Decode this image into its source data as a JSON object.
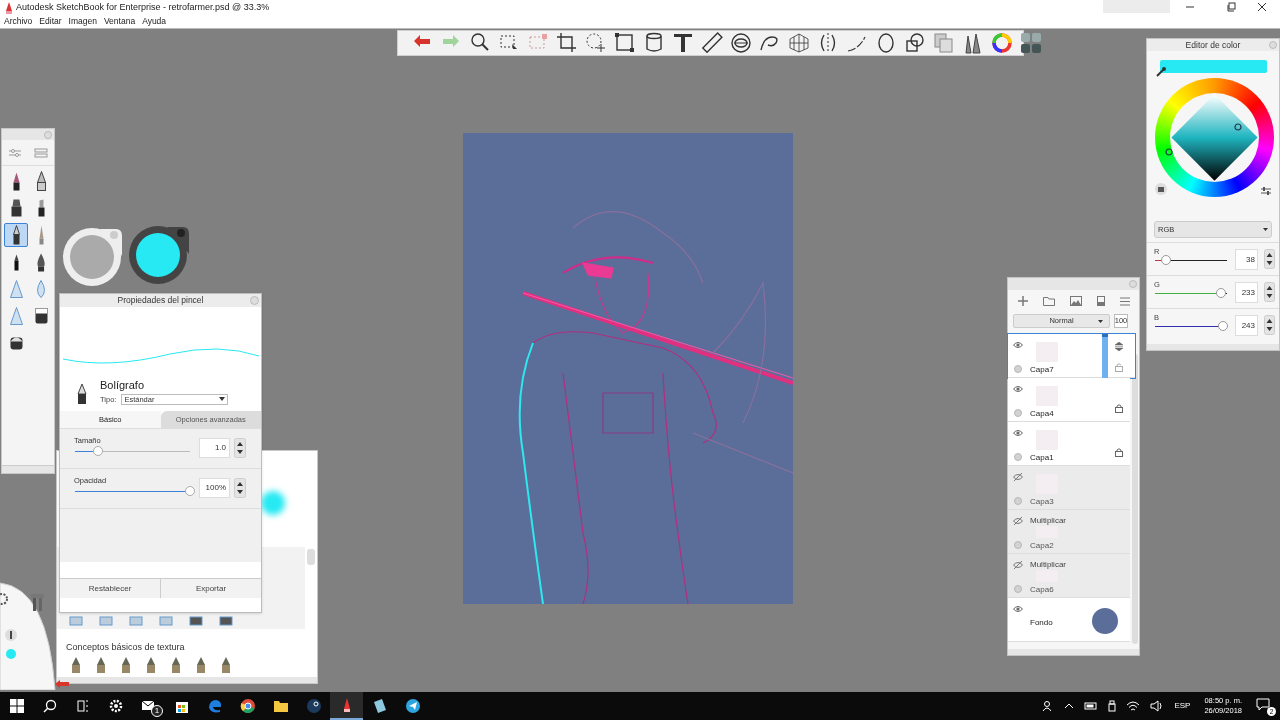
{
  "window": {
    "title": "Autodesk SketchBook for Enterprise - retrofarmer.psd @ 33.3%",
    "menu": [
      "Archivo",
      "Editar",
      "Imagen",
      "Ventana",
      "Ayuda"
    ]
  },
  "brush_palette": {
    "brushes": [
      {
        "selected": false
      },
      {
        "selected": false
      },
      {
        "selected": false
      },
      {
        "selected": false
      },
      {
        "selected": true
      },
      {
        "selected": false
      },
      {
        "selected": false
      },
      {
        "selected": false
      },
      {
        "selected": false
      },
      {
        "selected": false
      },
      {
        "selected": false
      },
      {
        "selected": false
      },
      {
        "selected": false
      }
    ]
  },
  "brush_properties": {
    "title": "Propiedades del pincel",
    "brush_name": "Bolígrafo",
    "type_label": "Tipo:",
    "type_value": "Estándar",
    "tabs": [
      {
        "label": "Básico",
        "selected": true
      },
      {
        "label": "Opciones avanzadas",
        "selected": false
      }
    ],
    "sliders": [
      {
        "label": "Tamaño",
        "level": 0.2,
        "value": "1.0"
      },
      {
        "label": "Opacidad",
        "level": 1.0,
        "value": "100%"
      }
    ],
    "buttons": [
      "Restablecer",
      "Exportar"
    ]
  },
  "brush_library": {
    "section_title": "Conceptos básicos de textura"
  },
  "layers": {
    "blend_mode": "Normal",
    "opacity": "100",
    "items": [
      {
        "name": "Capa7",
        "visible": true,
        "selected": true,
        "locked": false
      },
      {
        "name": "Capa4",
        "visible": true,
        "selected": false,
        "locked": true
      },
      {
        "name": "Capa1",
        "visible": true,
        "selected": false,
        "locked": true
      },
      {
        "name": "Capa3",
        "visible": false,
        "selected": false,
        "locked": false
      },
      {
        "name": "Capa2",
        "blend": "Multiplicar",
        "visible": false,
        "selected": false,
        "locked": false
      },
      {
        "name": "Capa6",
        "blend": "Multiplicar",
        "visible": false,
        "selected": false,
        "locked": false
      },
      {
        "name": "Fondo",
        "visible": true,
        "selected": false,
        "locked": false,
        "color": "#5a6e99"
      }
    ]
  },
  "color_editor": {
    "title": "Editor de color",
    "mode": "RGB",
    "channels": [
      {
        "label": "R",
        "value": "38",
        "level": 0.15
      },
      {
        "label": "G",
        "value": "233",
        "level": 0.91
      },
      {
        "label": "B",
        "value": "243",
        "level": 0.94
      }
    ]
  },
  "taskbar": {
    "mail_badge": "1",
    "language": "ESP",
    "time": "08:50 p. m.",
    "date": "26/09/2018",
    "notifications": "2"
  }
}
